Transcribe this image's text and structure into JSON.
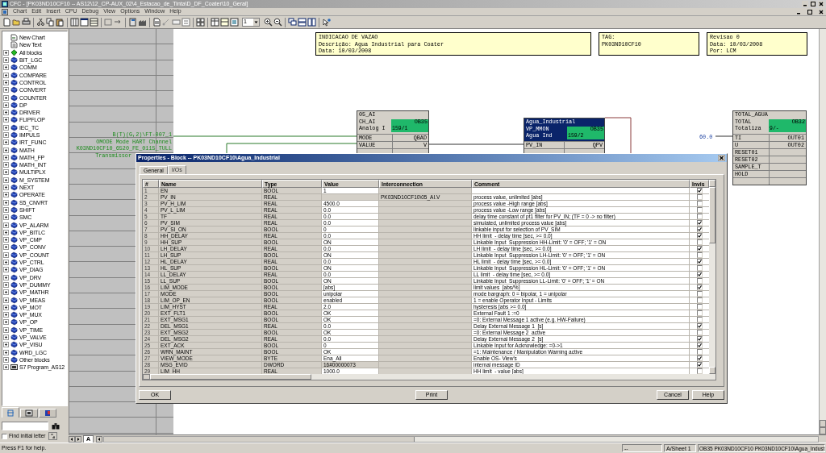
{
  "window": {
    "title": "CFC - [PK03ND10CF10 -- AS12\\12_CP-AUX_02\\4_Estacao_de_Tinta\\D_DF_Coater\\10_Geral]"
  },
  "menu": [
    "Chart",
    "Edit",
    "Insert",
    "CPU",
    "Debug",
    "View",
    "Options",
    "Window",
    "Help"
  ],
  "toolbar": {
    "zoom_value": "1"
  },
  "sidebar": {
    "items": [
      {
        "label": "New Chart",
        "kind": "chart"
      },
      {
        "label": "New Text",
        "kind": "text"
      },
      {
        "label": "All blocks",
        "kind": "all"
      },
      {
        "label": "BIT_LGC",
        "kind": "library"
      },
      {
        "label": "COMM",
        "kind": "library"
      },
      {
        "label": "COMPARE",
        "kind": "library"
      },
      {
        "label": "CONTROL",
        "kind": "library"
      },
      {
        "label": "CONVERT",
        "kind": "library"
      },
      {
        "label": "COUNTER",
        "kind": "library"
      },
      {
        "label": "DP",
        "kind": "library"
      },
      {
        "label": "DRIVER",
        "kind": "library"
      },
      {
        "label": "FLIPFLOP",
        "kind": "library"
      },
      {
        "label": "IEC_TC",
        "kind": "library"
      },
      {
        "label": "IMPULS",
        "kind": "library"
      },
      {
        "label": "IRT_FUNC",
        "kind": "library"
      },
      {
        "label": "MATH",
        "kind": "library"
      },
      {
        "label": "MATH_FP",
        "kind": "library"
      },
      {
        "label": "MATH_INT",
        "kind": "library"
      },
      {
        "label": "MULTIPLX",
        "kind": "library"
      },
      {
        "label": "M_SYSTEM",
        "kind": "library"
      },
      {
        "label": "NEXT",
        "kind": "library"
      },
      {
        "label": "OPERATE",
        "kind": "library"
      },
      {
        "label": "S5_CNVRT",
        "kind": "library"
      },
      {
        "label": "SHIFT",
        "kind": "library"
      },
      {
        "label": "SMC",
        "kind": "library"
      },
      {
        "label": "VP_ALARM",
        "kind": "library"
      },
      {
        "label": "VP_BITLC",
        "kind": "library"
      },
      {
        "label": "VP_CMP",
        "kind": "library"
      },
      {
        "label": "VP_CONV",
        "kind": "library"
      },
      {
        "label": "VP_COUNT",
        "kind": "library"
      },
      {
        "label": "VP_CTRL",
        "kind": "library"
      },
      {
        "label": "VP_DIAG",
        "kind": "library"
      },
      {
        "label": "VP_DRV",
        "kind": "library"
      },
      {
        "label": "VP_DUMMY",
        "kind": "library"
      },
      {
        "label": "VP_MATHR",
        "kind": "library"
      },
      {
        "label": "VP_MEAS",
        "kind": "library"
      },
      {
        "label": "VP_MOT",
        "kind": "library"
      },
      {
        "label": "VP_MUX",
        "kind": "library"
      },
      {
        "label": "VP_OP",
        "kind": "library"
      },
      {
        "label": "VP_TIME",
        "kind": "library"
      },
      {
        "label": "VP_VALVE",
        "kind": "library"
      },
      {
        "label": "VP_VISU",
        "kind": "library"
      },
      {
        "label": "WRD_LGC",
        "kind": "library"
      },
      {
        "label": "Other blocks",
        "kind": "library"
      },
      {
        "label": "S7 Program_AS12",
        "kind": "program"
      }
    ],
    "tabs": [
      {
        "selected": true
      },
      {
        "selected": false
      },
      {
        "selected": false
      }
    ],
    "find_initial_letter": {
      "label": "Find initial letter",
      "checked": false
    }
  },
  "chart": {
    "margin_texts": [
      "B(T)(G,2)\\FT-007_1",
      "OMODE Mode HART Channel",
      "K03ND10CF10_6520_FE_0115_TULL",
      "Transmissor"
    ],
    "title_blocks": [
      {
        "lines": [
          "INDICACAO DE VAZAO",
          "Descrição: Agua Industrial para Coater",
          "Data: 10/03/2008"
        ]
      },
      {
        "lines": [
          "TAG:",
          "PK03ND10CF10"
        ]
      },
      {
        "lines": [
          "Revisao 0",
          "Data: 10/03/2008",
          "Por: LCM"
        ]
      }
    ],
    "blocks": [
      {
        "name": "05_AI",
        "type": "CH_AI",
        "comment": "Analog I",
        "task": "OB35",
        "sequence": "159/1",
        "selected": false,
        "inputs": [
          "MODE",
          "VALUE"
        ],
        "outputs": [
          "QBAD",
          "V"
        ]
      },
      {
        "name": "Agua_Industrial",
        "type": "VP_MMON",
        "comment": "Agua Ind",
        "task": "OB35",
        "sequence": "159/2",
        "selected": true,
        "inputs": [
          "PV_IN"
        ],
        "outputs": [
          "QPV"
        ]
      },
      {
        "name": "TOTAL_AGUA",
        "type": "TOTAL",
        "comment": "Totaliza",
        "task": "OB32",
        "sequence": "9/-",
        "selected": false,
        "inputs": [
          "TI",
          "U",
          "RESET01",
          "RESET02",
          "SAMPLE_T",
          "HOLD"
        ],
        "outputs": [
          "OUT01",
          "OUT02"
        ]
      }
    ],
    "value_label": "60.0",
    "sheet_tab": "A"
  },
  "dialog": {
    "title": "Properties - Block -- PK03ND10CF10\\Agua_Industrial",
    "tabs": [
      {
        "label": "General",
        "selected": false
      },
      {
        "label": "I/Os",
        "selected": true
      }
    ],
    "columns": [
      "#",
      "Name",
      "Type",
      "Value",
      "Interconnection",
      "Comment",
      "Invis"
    ],
    "rows": [
      {
        "num": "1",
        "name": "EN",
        "type": "BOOL",
        "value": "1",
        "editable": true,
        "invisible": true
      },
      {
        "num": "2",
        "name": "PV_IN",
        "type": "REAL",
        "interconnection": "PK03ND10CF10\\05_AI.V",
        "comment": "process value, unlimited [abs]",
        "editable": false,
        "invisible": false
      },
      {
        "num": "3",
        "name": "PV_H_LIM",
        "type": "REAL",
        "value": "4500.0",
        "comment": "process value -High range [abs]",
        "editable": true,
        "invisible": false
      },
      {
        "num": "4",
        "name": "PV_L_LIM",
        "type": "REAL",
        "value": "0.0",
        "comment": "process value -Low range [abs]",
        "editable": true,
        "invisible": false
      },
      {
        "num": "5",
        "name": "TF",
        "type": "REAL",
        "value": "0.0",
        "comment": "delay time constant of pt1 filter for PV_IN; (TF = 0 -> no filter)",
        "editable": true,
        "invisible": false
      },
      {
        "num": "6",
        "name": "PV_SIM",
        "type": "REAL",
        "value": "0.0",
        "comment": "simulated, unlimited process value [abs]",
        "editable": true,
        "invisible": true
      },
      {
        "num": "7",
        "name": "PV_SI_ON",
        "type": "BOOL",
        "value": "0",
        "comment": "linkable input for selection of PV_SIM",
        "editable": true,
        "invisible": true
      },
      {
        "num": "8",
        "name": "HH_DELAY",
        "type": "REAL",
        "value": "0.0",
        "comment": "HH limit  - delay time [sec, >= 0.0]",
        "editable": true,
        "invisible": true
      },
      {
        "num": "9",
        "name": "HH_SUP",
        "type": "BOOL",
        "value": "ON",
        "comment": "Linkable Input  Suppression HH-Limit: '0' = OFF; '1' = ON",
        "editable": true,
        "invisible": false
      },
      {
        "num": "10",
        "name": "LH_DELAY",
        "type": "REAL",
        "value": "0.0",
        "comment": "LH limit  - delay time [sec, >= 0.0]",
        "editable": true,
        "invisible": true
      },
      {
        "num": "11",
        "name": "LH_SUP",
        "type": "BOOL",
        "value": "ON",
        "comment": "Linkable Input  Suppression LH-Limit: '0' = OFF; '1' = ON",
        "editable": true,
        "invisible": false
      },
      {
        "num": "12",
        "name": "HL_DELAY",
        "type": "REAL",
        "value": "0.0",
        "comment": "HL limit  - delay time [sec, >= 0.0]",
        "editable": true,
        "invisible": true
      },
      {
        "num": "13",
        "name": "HL_SUP",
        "type": "BOOL",
        "value": "ON",
        "comment": "Linkable Input  Suppression HL-Limit: '0' = OFF; '1' = ON",
        "editable": true,
        "invisible": false
      },
      {
        "num": "14",
        "name": "LL_DELAY",
        "type": "REAL",
        "value": "0.0",
        "comment": "LL limit  - delay time [sec, >= 0.0]",
        "editable": true,
        "invisible": true
      },
      {
        "num": "15",
        "name": "LL_SUP",
        "type": "BOOL",
        "value": "ON",
        "comment": "Linkable Input  Suppression LL-Limit: '0' = OFF; '1' = ON",
        "editable": true,
        "invisible": false
      },
      {
        "num": "16",
        "name": "LIM_MODE",
        "type": "BOOL",
        "value": "[abs]",
        "comment": "limit values  [abs/%]",
        "editable": true,
        "invisible": true
      },
      {
        "num": "17",
        "name": "MODE",
        "type": "BOOL",
        "value": "unipolar",
        "comment": "mode bargraph: 0 = bipolar, 1 = unipolar",
        "editable": true,
        "invisible": false
      },
      {
        "num": "18",
        "name": "LIM_OP_EN",
        "type": "BOOL",
        "value": "enabled",
        "comment": "1 = enable Operator Input - Limits",
        "editable": true,
        "invisible": false
      },
      {
        "num": "19",
        "name": "LIM_HYST",
        "type": "REAL",
        "value": "2.0",
        "comment": "hysteresis [abs >= 0.0]",
        "editable": true,
        "invisible": false
      },
      {
        "num": "20",
        "name": "EXT_FLT1",
        "type": "BOOL",
        "value": "OK",
        "comment": "External Fault 1 :=0",
        "editable": true,
        "invisible": false
      },
      {
        "num": "21",
        "name": "EXT_MSG1",
        "type": "BOOL",
        "value": "OK",
        "comment": "=0: External Message 1 active (e.g. HW-Failure)",
        "editable": true,
        "invisible": false
      },
      {
        "num": "22",
        "name": "DEL_MSG1",
        "type": "REAL",
        "value": "0.0",
        "comment": "Delay External Message 1  [s]",
        "editable": true,
        "invisible": true
      },
      {
        "num": "23",
        "name": "EXT_MSG2",
        "type": "BOOL",
        "value": "OK",
        "comment": "=0: External Message 2  active",
        "editable": true,
        "invisible": false
      },
      {
        "num": "24",
        "name": "DEL_MSG2",
        "type": "REAL",
        "value": "0.0",
        "comment": "Delay External Message 2  [s]",
        "editable": true,
        "invisible": true
      },
      {
        "num": "25",
        "name": "EXT_ACK",
        "type": "BOOL",
        "value": "0",
        "comment": "Linkable Input for Acknowledge: =0->1",
        "editable": true,
        "invisible": true
      },
      {
        "num": "26",
        "name": "WRN_MAINT",
        "type": "BOOL",
        "value": "OK",
        "comment": "=1: Maintenance / Manipulation Warning active",
        "editable": true,
        "invisible": false
      },
      {
        "num": "27",
        "name": "VIEW_MODE",
        "type": "BYTE",
        "value": "Ena_All",
        "comment": "Enable OS- View's",
        "editable": true,
        "invisible": true
      },
      {
        "num": "28",
        "name": "MSG_EVID",
        "type": "DWORD",
        "value": "16#00000073",
        "comment": "internal message ID",
        "editable": false,
        "invisible": true
      },
      {
        "num": "29",
        "name": "LIM_HH",
        "type": "REAL",
        "value": "1000.0",
        "comment": "HH limit  - value [abs]",
        "editable": true,
        "invisible": false
      }
    ],
    "buttons": [
      "OK",
      "Print",
      "Cancel",
      "Help"
    ]
  },
  "status_bar": {
    "help": "Press F1 for help.",
    "field_2": "--",
    "sheet": "A/Sheet 1",
    "location": "OB35 PK03ND10CF10 PK03ND10CF10\\Agua_Indust"
  }
}
